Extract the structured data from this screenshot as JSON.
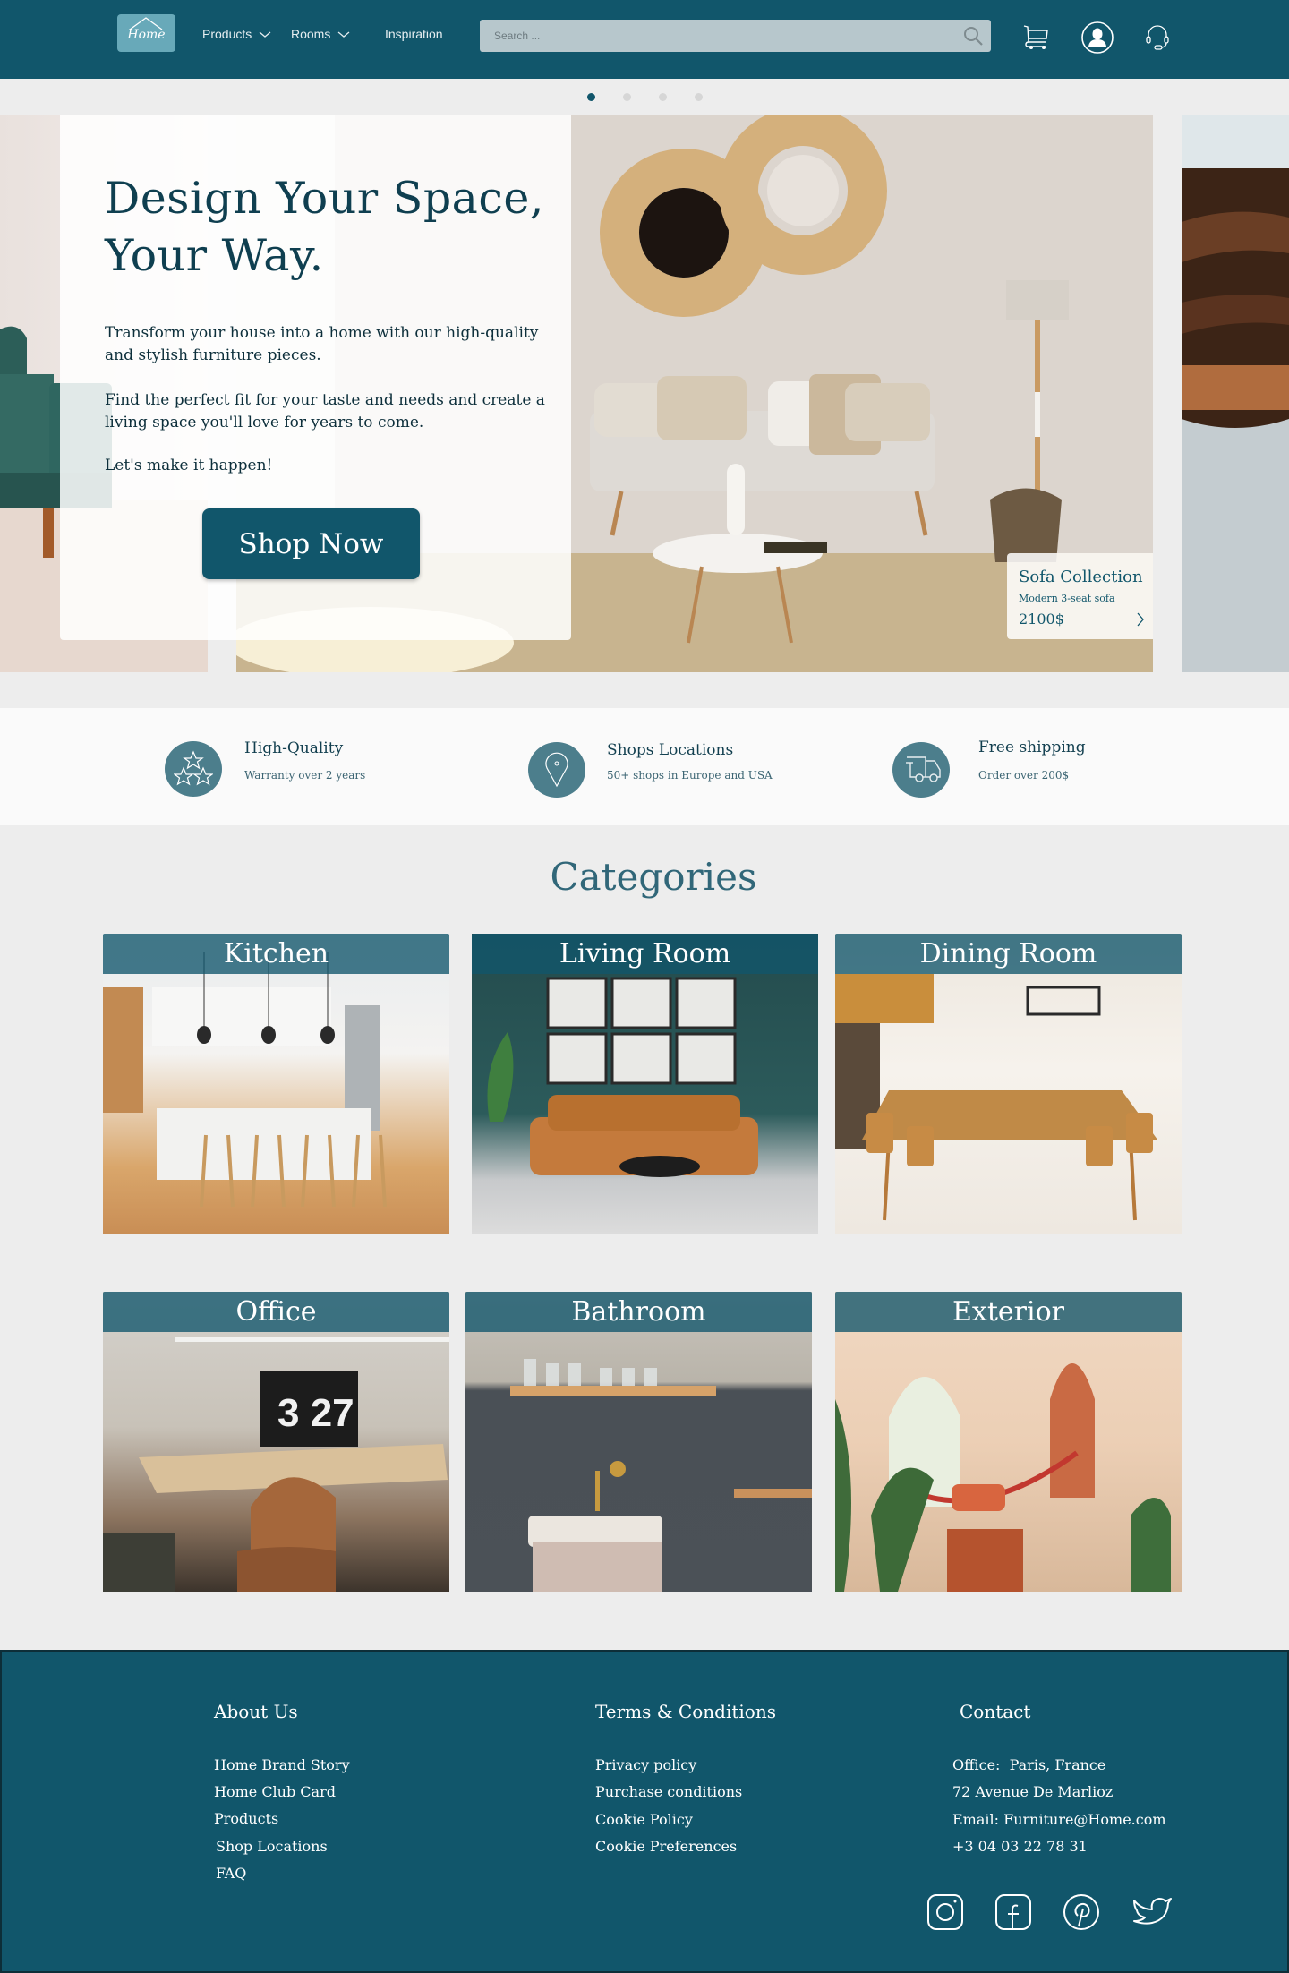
{
  "header": {
    "logo_text": "Home",
    "nav": [
      {
        "label": "Products",
        "has_dropdown": true
      },
      {
        "label": "Rooms",
        "has_dropdown": true
      },
      {
        "label": "Inspiration",
        "has_dropdown": false
      }
    ],
    "search": {
      "placeholder": "Search ...",
      "value": ""
    },
    "icons": [
      "search-icon",
      "cart-icon",
      "user-account-icon",
      "support-headset-icon"
    ]
  },
  "carousel": {
    "dots": 4,
    "active_index": 0,
    "hero": {
      "title": "Design Your Space, Your Way.",
      "paragraphs": [
        "Transform your house into a home with our high-quality and stylish furniture pieces.",
        "Find the perfect fit for your taste and needs and create a living space you'll love for years to come.",
        "Let's make it happen!"
      ],
      "cta_label": "Shop Now"
    },
    "product": {
      "title": "Sofa Collection",
      "subtitle": "Modern 3-seat sofa",
      "price": "2100$"
    }
  },
  "features": [
    {
      "icon": "stars-icon",
      "title": "High-Quality",
      "subtitle": "Warranty over 2 years"
    },
    {
      "icon": "location-pin-icon",
      "title": "Shops Locations",
      "subtitle": "50+ shops in Europe and USA"
    },
    {
      "icon": "delivery-truck-icon",
      "title": "Free shipping",
      "subtitle": "Order over 200$"
    }
  ],
  "categories": {
    "title": "Categories",
    "items": [
      {
        "label": "Kitchen"
      },
      {
        "label": "Living Room"
      },
      {
        "label": "Dining Room"
      },
      {
        "label": "Office"
      },
      {
        "label": "Bathroom"
      },
      {
        "label": "Exterior"
      }
    ]
  },
  "footer": {
    "about": {
      "heading": "About Us",
      "links": [
        "Home Brand Story",
        "Home Club Card",
        "Products",
        "Shop Locations",
        "FAQ"
      ]
    },
    "terms": {
      "heading": "Terms & Conditions",
      "links": [
        "Privacy policy",
        "Purchase conditions",
        "Cookie Policy",
        "Cookie Preferences"
      ]
    },
    "contact": {
      "heading": "Contact",
      "lines": [
        "Office:  Paris, France",
        "72 Avenue De Marlioz",
        "Email: Furniture@Home.com",
        "+3 04 03 22 78 31"
      ]
    },
    "social": [
      "instagram-icon",
      "facebook-icon",
      "pinterest-icon",
      "twitter-icon"
    ]
  },
  "colors": {
    "primary": "#11566b",
    "logo_bg": "#68a9b9",
    "feature_icon_bg": "#4c7e8c",
    "page_bg": "#ededed",
    "heading_text": "#316779"
  }
}
